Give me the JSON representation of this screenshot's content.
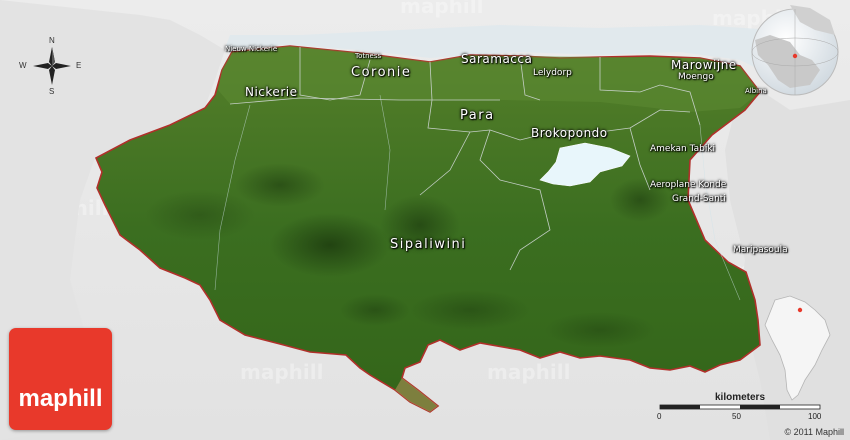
{
  "colors": {
    "land": "#3f7322",
    "land_dark": "#2c5718",
    "border": "#b0302a",
    "lake": "#e8f6fb",
    "ocean": "#e9edf0",
    "logo_bg": "#e8392b"
  },
  "compass": {
    "north": "N",
    "south": "S",
    "east": "E",
    "west": "W"
  },
  "districts": {
    "nickerie": "Nickerie",
    "coronie": "Coronie",
    "saramacca": "Saramacca",
    "marowijne": "Marowijne",
    "para": "Para",
    "brokopondo": "Brokopondo",
    "sipaliwini": "Sipaliwini"
  },
  "towns": {
    "nieuw_nickerie": "Nieuw Nickerie",
    "totness": "Totness",
    "lelydorp": "Lelydorp",
    "moengo": "Moengo",
    "albina": "Albina",
    "amekan_tabiki": "Amekan Tabiki",
    "aeroplane_konde": "Aeroplane Konde",
    "grand_santi": "Grand-Santi",
    "maripasoula": "Maripasoula"
  },
  "watermark": "maphill",
  "logo": {
    "text": "maphill"
  },
  "scale": {
    "unit_label": "kilometers",
    "ticks": [
      "0",
      "50",
      "100"
    ]
  },
  "copyright": "© 2011 Maphill"
}
